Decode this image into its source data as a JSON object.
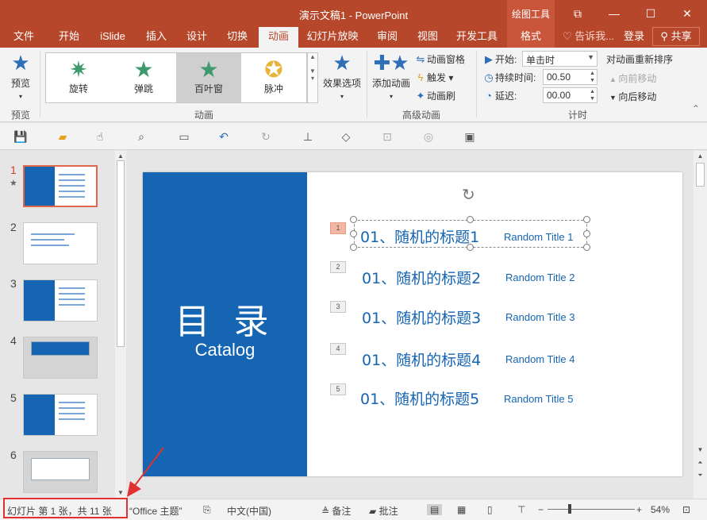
{
  "window": {
    "title": "演示文稿1 - PowerPoint",
    "context_group": "绘图工具",
    "buttons": {
      "pin": "⧉",
      "minimize": "—",
      "maximize": "☐",
      "close": "✕"
    }
  },
  "tabs": [
    {
      "label": "文件"
    },
    {
      "label": "开始"
    },
    {
      "label": "iSlide"
    },
    {
      "label": "插入"
    },
    {
      "label": "设计"
    },
    {
      "label": "切换"
    },
    {
      "label": "动画"
    },
    {
      "label": "幻灯片放映"
    },
    {
      "label": "审阅"
    },
    {
      "label": "视图"
    },
    {
      "label": "开发工具"
    },
    {
      "label": "格式"
    }
  ],
  "tell_me": "告诉我...",
  "login": "登录",
  "share": "共享",
  "ribbon": {
    "preview": {
      "label": "预览",
      "group": "预览"
    },
    "animation_gallery": {
      "items": [
        {
          "label": "旋转"
        },
        {
          "label": "弹跳"
        },
        {
          "label": "百叶窗"
        },
        {
          "label": "脉冲"
        }
      ],
      "effect_options": "效果选项",
      "group": "动画"
    },
    "advanced": {
      "add_animation": "添加动画",
      "animation_pane": "动画窗格",
      "trigger": "触发",
      "animation_painter": "动画刷",
      "group": "高级动画"
    },
    "timing": {
      "start_label": "开始:",
      "start_value": "单击时",
      "duration_label": "持续时间:",
      "duration_value": "00.50",
      "delay_label": "延迟:",
      "delay_value": "00.00",
      "reorder_title": "对动画重新排序",
      "move_earlier": "向前移动",
      "move_later": "向后移动",
      "group": "计时"
    }
  },
  "thumbnails": [
    {
      "num": "1"
    },
    {
      "num": "2"
    },
    {
      "num": "3"
    },
    {
      "num": "4"
    },
    {
      "num": "5"
    },
    {
      "num": "6"
    }
  ],
  "slide": {
    "catalog_cn": "目 录",
    "catalog_en": "Catalog",
    "items": [
      {
        "num": "1",
        "cn": "01、随机的标题1",
        "en": "Random Title 1"
      },
      {
        "num": "2",
        "cn": "01、随机的标题2",
        "en": "Random Title 2"
      },
      {
        "num": "3",
        "cn": "01、随机的标题3",
        "en": "Random Title 3"
      },
      {
        "num": "4",
        "cn": "01、随机的标题4",
        "en": "Random Title 4"
      },
      {
        "num": "5",
        "cn": "01、随机的标题5",
        "en": "Random Title 5"
      }
    ]
  },
  "statusbar": {
    "slide_info": "幻灯片 第 1 张，共 11 张",
    "theme": "“Office 主题”",
    "language": "中文(中国)",
    "notes": "备注",
    "comments": "批注",
    "zoom": "54%"
  },
  "colors": {
    "brand": "#b7472a",
    "slide_blue": "#1565b3",
    "highlight_red": "#e03030"
  }
}
